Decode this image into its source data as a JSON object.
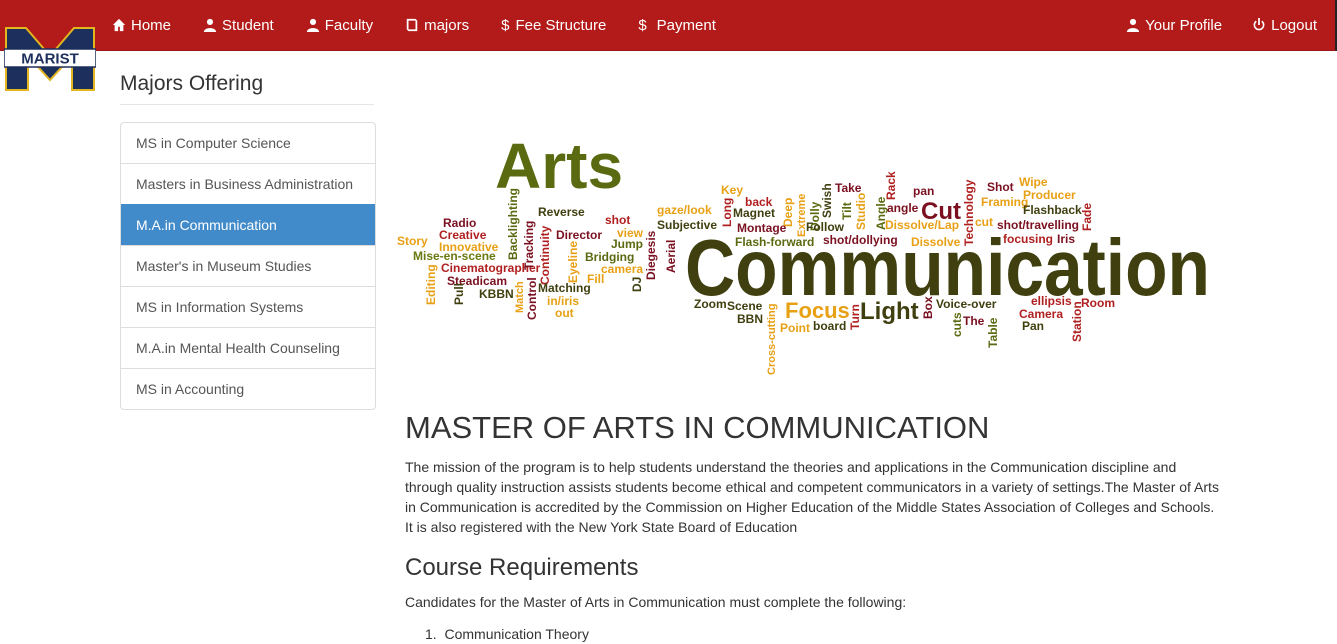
{
  "nav": {
    "left": [
      {
        "label": "Home",
        "icon": "home-icon"
      },
      {
        "label": "Student",
        "icon": "user-icon"
      },
      {
        "label": "Faculty",
        "icon": "user-icon"
      },
      {
        "label": "majors",
        "icon": "book-icon"
      },
      {
        "label": "Fee Structure",
        "icon": "dollar-icon"
      },
      {
        "label": "Payment",
        "icon": "dollar-icon"
      }
    ],
    "right": [
      {
        "label": "Your Profile",
        "icon": "user-icon"
      },
      {
        "label": "Logout",
        "icon": "power-icon"
      }
    ]
  },
  "logo": {
    "text": "MARIST",
    "letter": "M"
  },
  "sidebar": {
    "title": "Majors Offering",
    "items": [
      {
        "label": "MS in Computer Science",
        "active": false
      },
      {
        "label": "Masters in Business Administration",
        "active": false
      },
      {
        "label": "M.A.in Communication",
        "active": true
      },
      {
        "label": "Master's in Museum Studies",
        "active": false
      },
      {
        "label": "MS in Information Systems",
        "active": false
      },
      {
        "label": "M.A.in Mental Health Counseling",
        "active": false
      },
      {
        "label": "MS in Accounting",
        "active": false
      }
    ]
  },
  "wordcloud": {
    "main": "Communication",
    "arts": "Arts",
    "words": [
      "Story",
      "Radio",
      "Creative",
      "Innovative",
      "Mise-en-scene",
      "Cinematographer",
      "Editing",
      "Steadicam",
      "Pull",
      "KBBN",
      "Backlighting",
      "Tracking",
      "Match",
      "Control",
      "Continuity",
      "Reverse",
      "Director",
      "Eyeline",
      "Fill",
      "Matching",
      "in/iris",
      "out",
      "shot",
      "view",
      "Jump",
      "Bridging",
      "camera",
      "DJ",
      "Diegesis",
      "Aerial",
      "gaze/look",
      "Subjective",
      "Long",
      "Key",
      "Magnet",
      "back",
      "Deep",
      "Montage",
      "Extreme",
      "Dolly",
      "Swish",
      "Follow",
      "Tilt",
      "Studio",
      "Take",
      "Flash-forward",
      "shot/dollying",
      "Angle",
      "Rack",
      "angle",
      "pan",
      "Cut",
      "Dissolve/Lap",
      "Dissolve",
      "Technology",
      "Shot",
      "Wipe",
      "Framing",
      "Producer",
      "cut",
      "Flashback",
      "Fade",
      "shot/travelling",
      "focusing",
      "Iris",
      "Zoom",
      "Scene",
      "BBN",
      "Cross-cutting",
      "Focus",
      "Point",
      "board",
      "Turn",
      "Light",
      "Box",
      "Voice-over",
      "cuts",
      "The",
      "Table",
      "Camera",
      "Pan",
      "ellipsis",
      "Station",
      "Room"
    ],
    "colors": {
      "olive": "#5a6a10",
      "dark": "#3f3f10",
      "orange": "#e8a015",
      "maroon": "#7a1020",
      "red": "#b02020",
      "green": "#6a7a10"
    }
  },
  "content": {
    "title": "MASTER OF ARTS IN COMMUNICATION",
    "mission": "The mission of the program is to help students understand the theories and applications in the Communication discipline and through quality instruction assists students become ethical and competent communicators in a variety of settings.The Master of Arts in Communication is accredited by the Commission on Higher Education of the Middle States Association of Colleges and Schools. It is also registered with the New York State Board of Education",
    "requirements_title": "Course Requirements",
    "requirements_intro": "Candidates for the Master of Arts in Communication must complete the following:",
    "courses": [
      "Communication Theory"
    ]
  }
}
